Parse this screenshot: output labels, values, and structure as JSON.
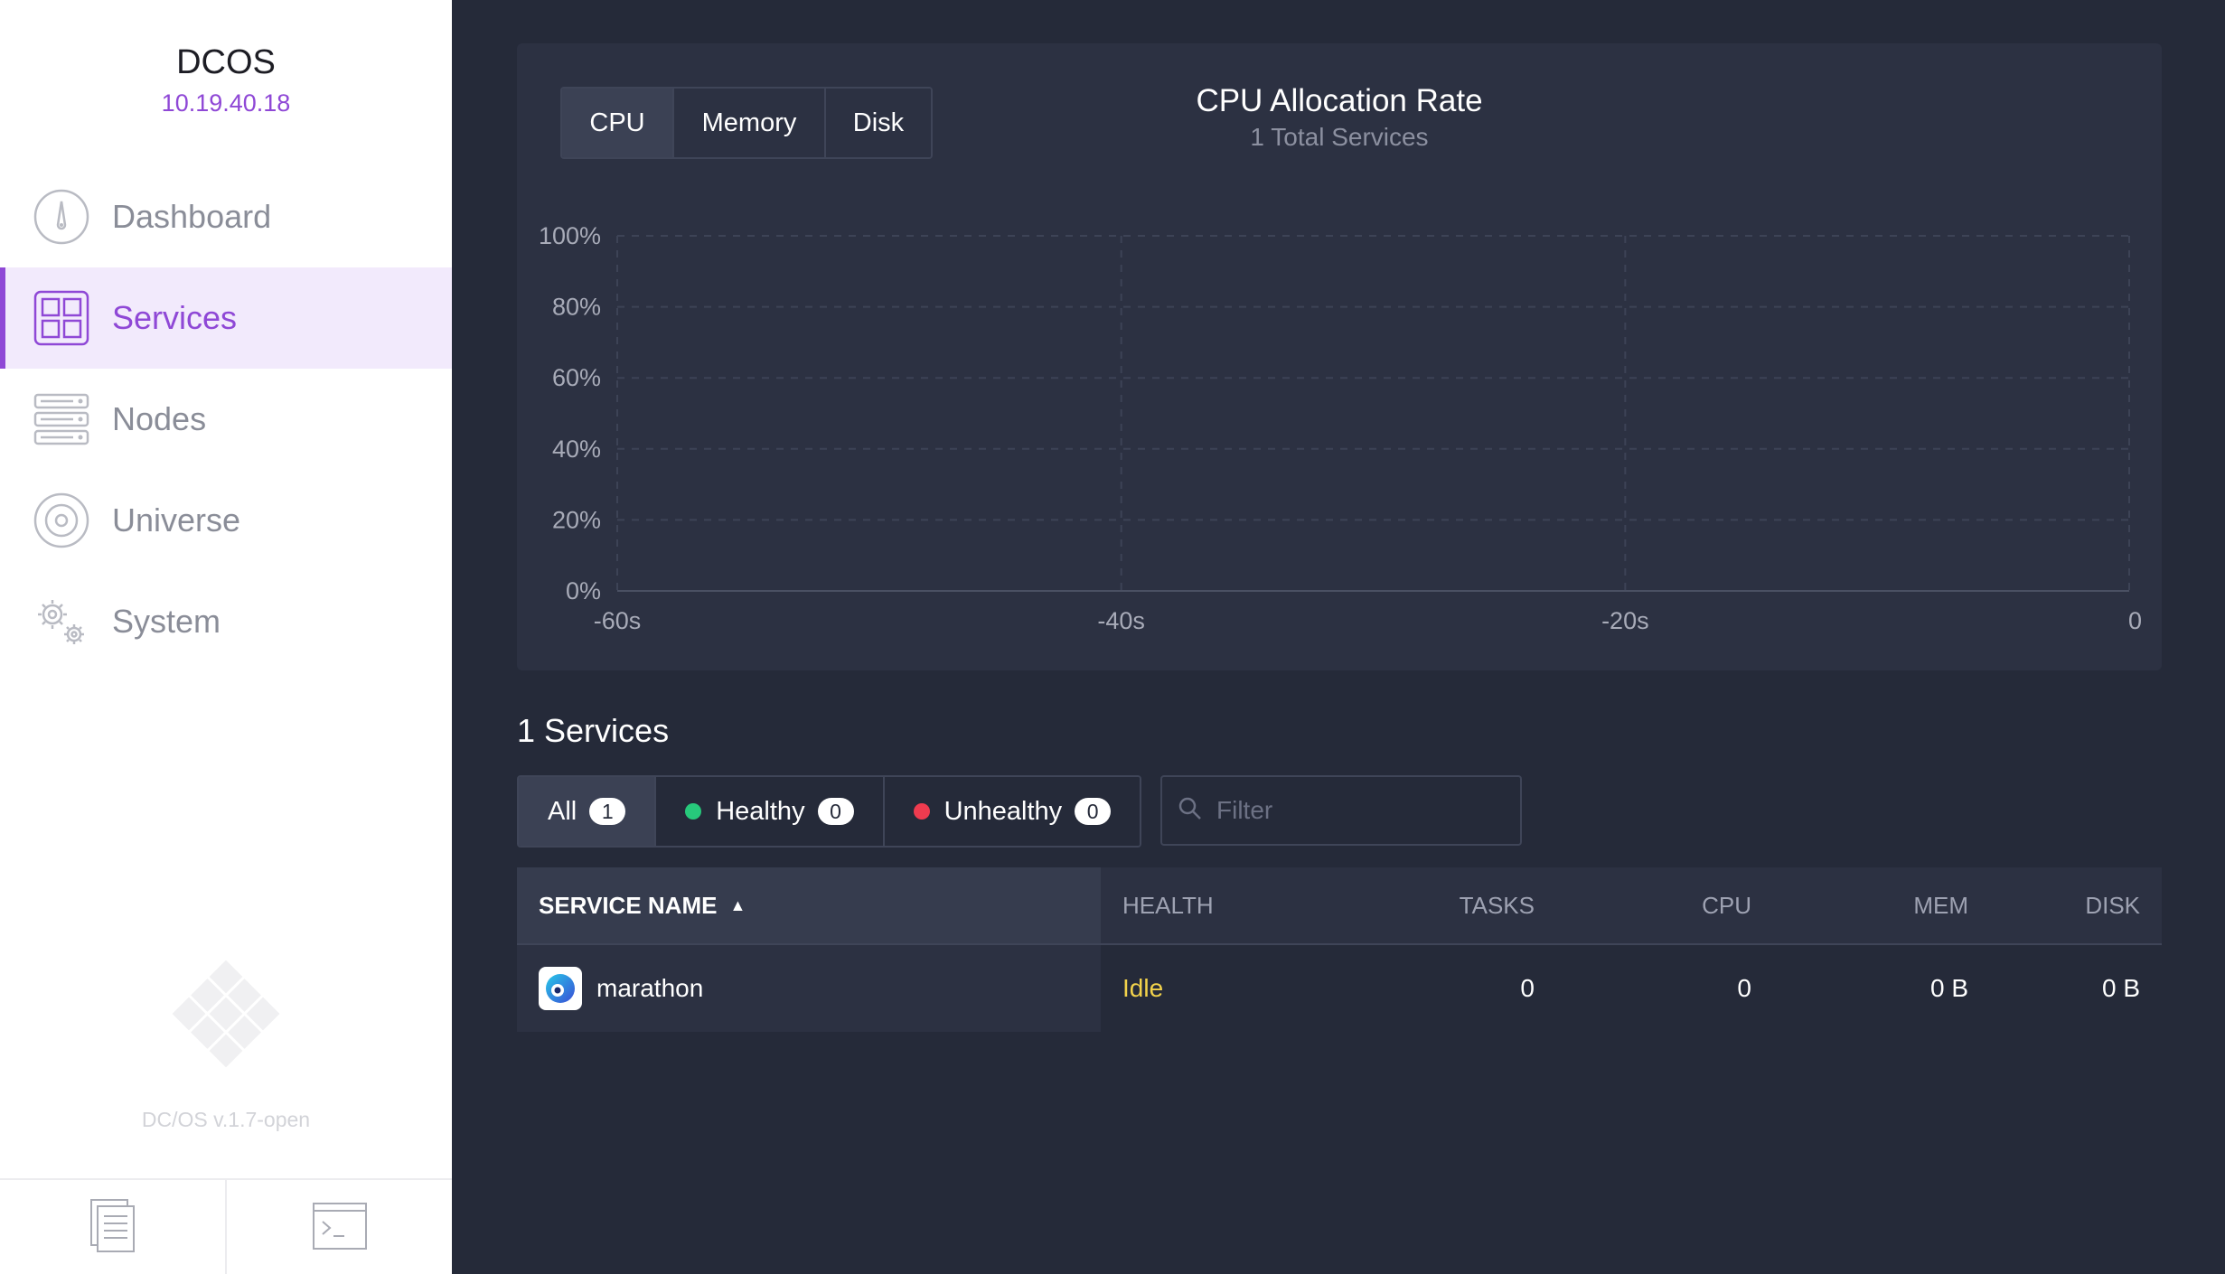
{
  "sidebar": {
    "brand": "DCOS",
    "cluster_ip": "10.19.40.18",
    "items": [
      {
        "label": "Dashboard",
        "icon": "dashboard-icon",
        "active": false
      },
      {
        "label": "Services",
        "icon": "services-icon",
        "active": true
      },
      {
        "label": "Nodes",
        "icon": "nodes-icon",
        "active": false
      },
      {
        "label": "Universe",
        "icon": "universe-icon",
        "active": false
      },
      {
        "label": "System",
        "icon": "system-icon",
        "active": false
      }
    ],
    "version": "DC/OS v.1.7-open",
    "footer": [
      "documentation-icon",
      "terminal-icon"
    ],
    "accent_color": "#8f48d6"
  },
  "chart": {
    "tabs": [
      {
        "label": "CPU",
        "active": true
      },
      {
        "label": "Memory",
        "active": false
      },
      {
        "label": "Disk",
        "active": false
      }
    ],
    "title": "CPU Allocation Rate",
    "subtitle": "1 Total Services"
  },
  "chart_data": {
    "type": "area",
    "title": "CPU Allocation Rate",
    "subtitle": "1 Total Services",
    "x_ticks": [
      "-60s",
      "-40s",
      "-20s",
      "0"
    ],
    "y_ticks": [
      "0%",
      "20%",
      "40%",
      "60%",
      "80%",
      "100%"
    ],
    "xlim": [
      -60,
      0
    ],
    "ylim": [
      0,
      100
    ],
    "series": [],
    "grid": true
  },
  "services": {
    "heading": "1 Services",
    "filters": [
      {
        "label": "All",
        "count": "1",
        "active": true
      },
      {
        "label": "Healthy",
        "count": "0",
        "dot_color": "#27c97b"
      },
      {
        "label": "Unhealthy",
        "count": "0",
        "dot_color": "#ef3b4f"
      }
    ],
    "filter_placeholder": "Filter"
  },
  "table": {
    "columns": {
      "name": "SERVICE NAME",
      "health": "HEALTH",
      "tasks": "TASKS",
      "cpu": "CPU",
      "mem": "MEM",
      "disk": "DISK"
    },
    "sort_indicator": "▲",
    "rows": [
      {
        "name": "marathon",
        "health": "Idle",
        "tasks": "0",
        "cpu": "0",
        "mem": "0 B",
        "disk": "0 B"
      }
    ]
  }
}
